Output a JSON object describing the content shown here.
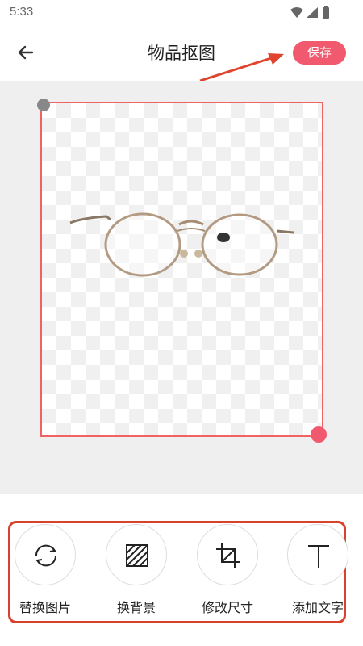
{
  "status": {
    "time": "5:33"
  },
  "header": {
    "title": "物品抠图",
    "save_label": "保存"
  },
  "colors": {
    "accent": "#f0596e",
    "frame": "#ef6363",
    "highlight_box": "#d8412c"
  },
  "tools": [
    {
      "label": "替换图片",
      "icon": "refresh-icon"
    },
    {
      "label": "换背景",
      "icon": "background-pattern-icon"
    },
    {
      "label": "修改尺寸",
      "icon": "crop-icon"
    },
    {
      "label": "添加文字",
      "icon": "text-icon"
    }
  ]
}
